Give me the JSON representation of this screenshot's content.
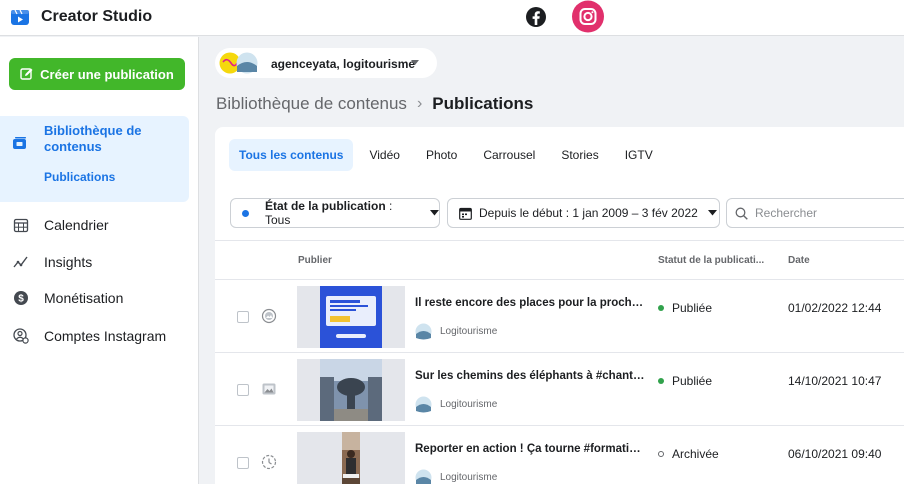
{
  "topbar": {
    "title": "Creator Studio",
    "icons": [
      "creator-studio-icon",
      "facebook-icon",
      "instagram-icon"
    ],
    "instagram_color": "#e1306c"
  },
  "sidebar": {
    "create_label": "Créer une publication",
    "create_color": "#42b72a",
    "library": {
      "label": "Bibliothèque de contenus",
      "sub": "Publications"
    },
    "items": [
      {
        "label": "Calendrier",
        "icon": "calendar-icon"
      },
      {
        "label": "Insights",
        "icon": "insights-icon"
      },
      {
        "label": "Monétisation",
        "icon": "monetization-icon"
      },
      {
        "label": "Comptes Instagram",
        "icon": "instagram-accounts-icon"
      }
    ]
  },
  "account": {
    "name": "agenceyata, logitourisme"
  },
  "breadcrumb": {
    "parent": "Bibliothèque de contenus",
    "current": "Publications"
  },
  "tabs": [
    {
      "label": "Tous les contenus",
      "active": true
    },
    {
      "label": "Vidéo",
      "active": false
    },
    {
      "label": "Photo",
      "active": false
    },
    {
      "label": "Carrousel",
      "active": false
    },
    {
      "label": "Stories",
      "active": false
    },
    {
      "label": "IGTV",
      "active": false
    }
  ],
  "filters": {
    "status_label": "État de la publication",
    "status_value": " : Tous",
    "date_label": "Depuis le début : 1 jan 2009 – 3 fév 2022",
    "search_placeholder": "Rechercher"
  },
  "table": {
    "headers": {
      "publish": "Publier",
      "status": "Statut de la publicati...",
      "date": "Date"
    },
    "rows": [
      {
        "title": "Il reste encore des places pour la prochaine…",
        "owner": "Logitourisme",
        "status": "Publiée",
        "status_type": "published",
        "date": "01/02/2022 12:44",
        "type_icon": "carousel-icon"
      },
      {
        "title": "Sur les chemins des éléphants à #chantier…",
        "owner": "Logitourisme",
        "status": "Publiée",
        "status_type": "published",
        "date": "14/10/2021 10:47",
        "type_icon": "photo-icon"
      },
      {
        "title": "Reporter en action ! Ça tourne #formation…",
        "owner": "Logitourisme",
        "status": "Archivée",
        "status_type": "archived",
        "date": "06/10/2021 09:40",
        "type_icon": "story-icon"
      }
    ]
  },
  "colors": {
    "accent": "#1b74e4",
    "published": "#31a24c"
  }
}
